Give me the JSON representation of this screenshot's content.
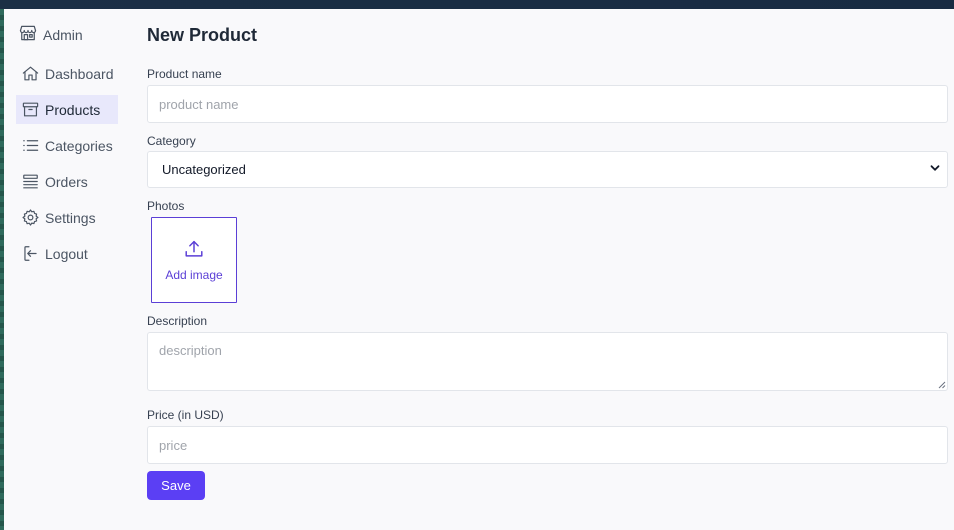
{
  "sidebar": {
    "brand": "Admin",
    "items": [
      {
        "label": "Dashboard",
        "icon": "home-icon"
      },
      {
        "label": "Products",
        "icon": "archive-box-icon",
        "active": true
      },
      {
        "label": "Categories",
        "icon": "list-icon"
      },
      {
        "label": "Orders",
        "icon": "stack-icon"
      },
      {
        "label": "Settings",
        "icon": "gear-icon"
      },
      {
        "label": "Logout",
        "icon": "logout-icon"
      }
    ]
  },
  "form": {
    "title": "New Product",
    "product_name_label": "Product name",
    "product_name_placeholder": "product name",
    "category_label": "Category",
    "category_value": "Uncategorized",
    "photos_label": "Photos",
    "add_image_label": "Add image",
    "description_label": "Description",
    "description_placeholder": "description",
    "price_label": "Price (in USD)",
    "price_placeholder": "price",
    "save_label": "Save"
  },
  "colors": {
    "accent": "#5b3ff4",
    "active_nav_bg": "#e8e8fb",
    "page_bg": "#f9f9fb"
  }
}
